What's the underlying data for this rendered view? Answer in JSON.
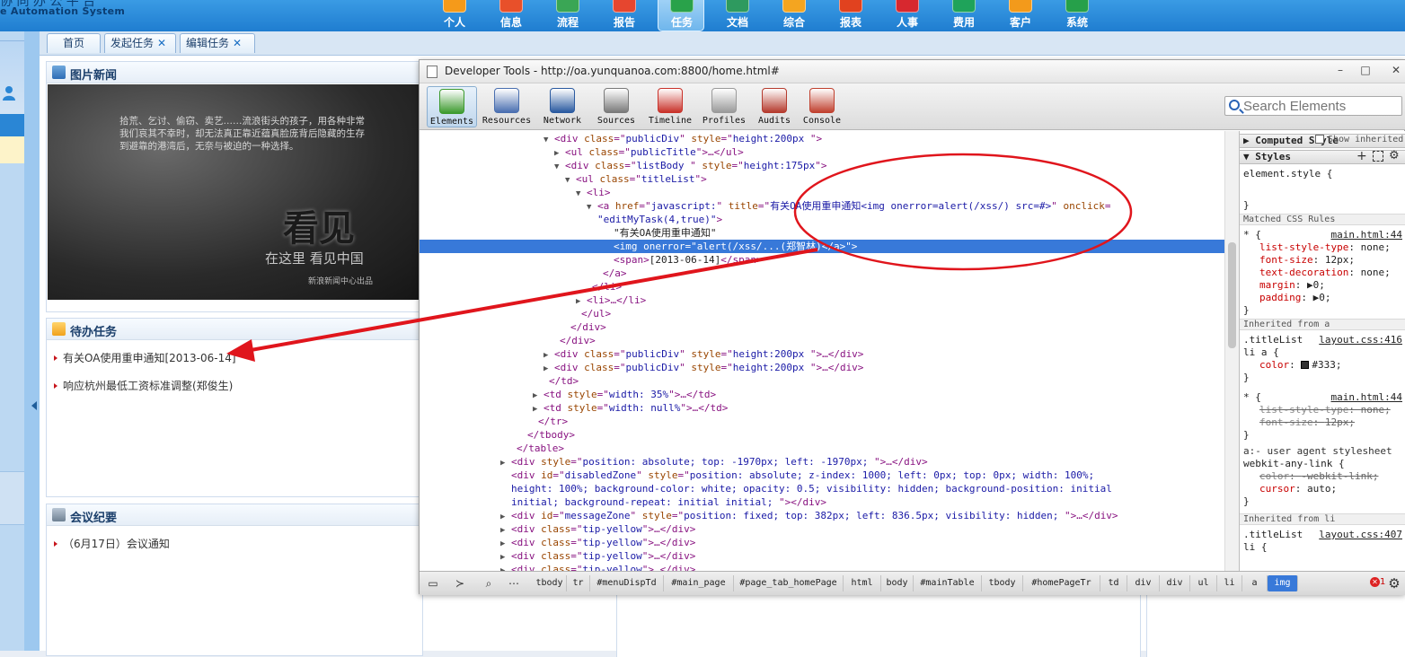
{
  "app": {
    "logo_main": "协 同 办 公 平 台",
    "logo_sub": "e Automation System",
    "modules": [
      {
        "label": "个人",
        "color": "#f59a1a"
      },
      {
        "label": "信息",
        "color": "#e8502a"
      },
      {
        "label": "流程",
        "color": "#3aa655"
      },
      {
        "label": "报告",
        "color": "#e6462f"
      },
      {
        "label": "任务",
        "color": "#29a24a"
      },
      {
        "label": "文档",
        "color": "#2e9a5f"
      },
      {
        "label": "综合",
        "color": "#f4a520"
      },
      {
        "label": "报表",
        "color": "#e1421f"
      },
      {
        "label": "人事",
        "color": "#d7282f"
      },
      {
        "label": "费用",
        "color": "#1fa35a"
      },
      {
        "label": "客户",
        "color": "#f39a1b"
      },
      {
        "label": "系统",
        "color": "#26a04a"
      }
    ],
    "active_module": "任务",
    "tabs": [
      {
        "label": "首页",
        "closable": false
      },
      {
        "label": "发起任务",
        "closable": true
      },
      {
        "label": "编辑任务",
        "closable": true
      }
    ],
    "close_glyph": "✕"
  },
  "panels": {
    "news": {
      "title": "图片新闻",
      "image_text_1": "拾荒、乞讨、偷窃、卖艺……流浪街头的孩子，用各种非常",
      "image_text_2": "我们哀其不幸时，却无法真正靠近蕴真脸庞背后隐藏的生存",
      "image_text_3": "到避靠的港湾后，无奈与被迫的一种选择。",
      "image_logo": "看见",
      "image_slogan": "在这里 看见中国",
      "image_credit": "新浪新闻中心出品"
    },
    "tasks": {
      "title": "待办任务",
      "items": [
        "有关OA使用重申通知[2013-06-14]",
        "响应杭州最低工资标准调整(郑俊生)"
      ]
    },
    "meetings": {
      "title": "会议纪要",
      "items": [
        "（6月17日）会议通知"
      ]
    }
  },
  "devtools": {
    "title": "Developer Tools - http://oa.yunquanoa.com:8800/home.html#",
    "window_buttons": [
      "–",
      "□",
      "✕"
    ],
    "tools": [
      {
        "label": "Elements",
        "active": true,
        "color": "#3c9a2e"
      },
      {
        "label": "Resources",
        "active": false,
        "color": "#4a6fb0"
      },
      {
        "label": "Network",
        "active": false,
        "color": "#2a5aa0"
      },
      {
        "label": "Sources",
        "active": false,
        "color": "#7a7a7a"
      },
      {
        "label": "Timeline",
        "active": false,
        "color": "#c9322a"
      },
      {
        "label": "Profiles",
        "active": false,
        "color": "#9a9a9a"
      },
      {
        "label": "Audits",
        "active": false,
        "color": "#b53b2e"
      },
      {
        "label": "Console",
        "active": false,
        "color": "#c0412f"
      }
    ],
    "search_placeholder": "Search Elements",
    "dom_lines": [
      {
        "indent": 24,
        "tw": "▼",
        "parts": [
          [
            "tg",
            "<div "
          ],
          [
            "an",
            "class"
          ],
          [
            "tg",
            "=\""
          ],
          [
            "av",
            "publicDiv"
          ],
          [
            "tg",
            "\" "
          ],
          [
            "an",
            "style"
          ],
          [
            "tg",
            "=\""
          ],
          [
            "av",
            "height:200px "
          ],
          [
            "tg",
            "\">"
          ]
        ]
      },
      {
        "indent": 26,
        "tw": "▶",
        "parts": [
          [
            "tg",
            "<ul "
          ],
          [
            "an",
            "class"
          ],
          [
            "tg",
            "=\""
          ],
          [
            "av",
            "publicTitle"
          ],
          [
            "tg",
            "\">…</ul>"
          ]
        ]
      },
      {
        "indent": 26,
        "tw": "▼",
        "parts": [
          [
            "tg",
            "<div "
          ],
          [
            "an",
            "class"
          ],
          [
            "tg",
            "=\""
          ],
          [
            "av",
            "listBody "
          ],
          [
            "tg",
            "\" "
          ],
          [
            "an",
            "style"
          ],
          [
            "tg",
            "=\""
          ],
          [
            "av",
            "height:175px"
          ],
          [
            "tg",
            "\">"
          ]
        ]
      },
      {
        "indent": 28,
        "tw": "▼",
        "parts": [
          [
            "tg",
            "<ul "
          ],
          [
            "an",
            "class"
          ],
          [
            "tg",
            "=\""
          ],
          [
            "av",
            "titleList"
          ],
          [
            "tg",
            "\">"
          ]
        ]
      },
      {
        "indent": 30,
        "tw": "▼",
        "parts": [
          [
            "tg",
            "<li>"
          ]
        ]
      },
      {
        "indent": 32,
        "tw": "▼",
        "parts": [
          [
            "tg",
            "<a "
          ],
          [
            "an",
            "href"
          ],
          [
            "tg",
            "=\""
          ],
          [
            "av",
            "javascript:"
          ],
          [
            "tg",
            "\" "
          ],
          [
            "an",
            "title"
          ],
          [
            "tg",
            "=\""
          ],
          [
            "av",
            "有关OA使用重申通知<img onerror=alert(/xss/) src=#>"
          ],
          [
            "tg",
            "\" "
          ],
          [
            "an",
            "onclick"
          ],
          [
            "tg",
            "="
          ]
        ]
      },
      {
        "indent": 32,
        "tw": "",
        "parts": [
          [
            "av",
            "\"editMyTask(4,true)\""
          ],
          [
            "tg",
            ">"
          ]
        ]
      },
      {
        "indent": 35,
        "tw": "",
        "parts": [
          [
            "tx",
            "\"有关OA使用重申通知\""
          ]
        ]
      },
      {
        "indent": 35,
        "tw": "",
        "sel": true,
        "parts": [
          [
            "tg",
            "<img "
          ],
          [
            "an",
            "onerror"
          ],
          [
            "tg",
            "=\""
          ],
          [
            "av",
            "alert(/xss/...(郑智林)</a>"
          ],
          [
            "tg",
            "\">"
          ]
        ]
      },
      {
        "indent": 35,
        "tw": "",
        "parts": [
          [
            "tg",
            "<span>"
          ],
          [
            "tx",
            "[2013-06-14]"
          ],
          [
            "tg",
            "</span>"
          ]
        ]
      },
      {
        "indent": 33,
        "tw": "",
        "parts": [
          [
            "tg",
            "</a>"
          ]
        ]
      },
      {
        "indent": 31,
        "tw": "",
        "parts": [
          [
            "tg",
            "</li>"
          ]
        ]
      },
      {
        "indent": 30,
        "tw": "▶",
        "parts": [
          [
            "tg",
            "<li>…</li>"
          ]
        ]
      },
      {
        "indent": 29,
        "tw": "",
        "parts": [
          [
            "tg",
            "</ul>"
          ]
        ]
      },
      {
        "indent": 27,
        "tw": "",
        "parts": [
          [
            "tg",
            "</div>"
          ]
        ]
      },
      {
        "indent": 25,
        "tw": "",
        "parts": [
          [
            "tg",
            "</div>"
          ]
        ]
      },
      {
        "indent": 24,
        "tw": "▶",
        "parts": [
          [
            "tg",
            "<div "
          ],
          [
            "an",
            "class"
          ],
          [
            "tg",
            "=\""
          ],
          [
            "av",
            "publicDiv"
          ],
          [
            "tg",
            "\" "
          ],
          [
            "an",
            "style"
          ],
          [
            "tg",
            "=\""
          ],
          [
            "av",
            "height:200px "
          ],
          [
            "tg",
            "\">…</div>"
          ]
        ]
      },
      {
        "indent": 24,
        "tw": "▶",
        "parts": [
          [
            "tg",
            "<div "
          ],
          [
            "an",
            "class"
          ],
          [
            "tg",
            "=\""
          ],
          [
            "av",
            "publicDiv"
          ],
          [
            "tg",
            "\" "
          ],
          [
            "an",
            "style"
          ],
          [
            "tg",
            "=\""
          ],
          [
            "av",
            "height:200px "
          ],
          [
            "tg",
            "\">…</div>"
          ]
        ]
      },
      {
        "indent": 23,
        "tw": "",
        "parts": [
          [
            "tg",
            "</td>"
          ]
        ]
      },
      {
        "indent": 22,
        "tw": "▶",
        "parts": [
          [
            "tg",
            "<td "
          ],
          [
            "an",
            "style"
          ],
          [
            "tg",
            "=\""
          ],
          [
            "av",
            "width: 35%"
          ],
          [
            "tg",
            "\">…</td>"
          ]
        ]
      },
      {
        "indent": 22,
        "tw": "▶",
        "parts": [
          [
            "tg",
            "<td "
          ],
          [
            "an",
            "style"
          ],
          [
            "tg",
            "=\""
          ],
          [
            "av",
            "width: null%"
          ],
          [
            "tg",
            "\">…</td>"
          ]
        ]
      },
      {
        "indent": 21,
        "tw": "",
        "parts": [
          [
            "tg",
            "</tr>"
          ]
        ]
      },
      {
        "indent": 19,
        "tw": "",
        "parts": [
          [
            "tg",
            "</tbody>"
          ]
        ]
      },
      {
        "indent": 17,
        "tw": "",
        "parts": [
          [
            "tg",
            "</table>"
          ]
        ]
      },
      {
        "indent": 16,
        "tw": "▶",
        "parts": [
          [
            "tg",
            "<div "
          ],
          [
            "an",
            "style"
          ],
          [
            "tg",
            "=\""
          ],
          [
            "av",
            "position: absolute; top: -1970px; left: -1970px; "
          ],
          [
            "tg",
            "\">…</div>"
          ]
        ]
      },
      {
        "indent": 16,
        "tw": "",
        "parts": [
          [
            "tg",
            "<div "
          ],
          [
            "an",
            "id"
          ],
          [
            "tg",
            "=\""
          ],
          [
            "av",
            "disabledZone"
          ],
          [
            "tg",
            "\" "
          ],
          [
            "an",
            "style"
          ],
          [
            "tg",
            "=\""
          ],
          [
            "av",
            "position: absolute; z-index: 1000; left: 0px; top: 0px; width: 100%;"
          ]
        ]
      },
      {
        "indent": 16,
        "tw": "",
        "parts": [
          [
            "av",
            "height: 100%; background-color: white; opacity: 0.5; visibility: hidden; background-position: initial"
          ]
        ]
      },
      {
        "indent": 16,
        "tw": "",
        "parts": [
          [
            "av",
            "initial; background-repeat: initial initial; "
          ],
          [
            "tg",
            "\"></div>"
          ]
        ]
      },
      {
        "indent": 16,
        "tw": "▶",
        "parts": [
          [
            "tg",
            "<div "
          ],
          [
            "an",
            "id"
          ],
          [
            "tg",
            "=\""
          ],
          [
            "av",
            "messageZone"
          ],
          [
            "tg",
            "\" "
          ],
          [
            "an",
            "style"
          ],
          [
            "tg",
            "=\""
          ],
          [
            "av",
            "position: fixed; top: 382px; left: 836.5px; visibility: hidden; "
          ],
          [
            "tg",
            "\">…</div>"
          ]
        ]
      },
      {
        "indent": 16,
        "tw": "▶",
        "parts": [
          [
            "tg",
            "<div "
          ],
          [
            "an",
            "class"
          ],
          [
            "tg",
            "=\""
          ],
          [
            "av",
            "tip-yellow"
          ],
          [
            "tg",
            "\">…</div>"
          ]
        ]
      },
      {
        "indent": 16,
        "tw": "▶",
        "parts": [
          [
            "tg",
            "<div "
          ],
          [
            "an",
            "class"
          ],
          [
            "tg",
            "=\""
          ],
          [
            "av",
            "tip-yellow"
          ],
          [
            "tg",
            "\">…</div>"
          ]
        ]
      },
      {
        "indent": 16,
        "tw": "▶",
        "parts": [
          [
            "tg",
            "<div "
          ],
          [
            "an",
            "class"
          ],
          [
            "tg",
            "=\""
          ],
          [
            "av",
            "tip-yellow"
          ],
          [
            "tg",
            "\">…</div>"
          ]
        ]
      },
      {
        "indent": 16,
        "tw": "▶",
        "parts": [
          [
            "tg",
            "<div "
          ],
          [
            "an",
            "class"
          ],
          [
            "tg",
            "=\""
          ],
          [
            "av",
            "tip-yellow"
          ],
          [
            "tg",
            "\">…</div>"
          ]
        ]
      }
    ],
    "sidebar": {
      "computed_label": "Computed Style",
      "show_inherited_label": "Show inherited",
      "styles_label": "Styles",
      "element_style": "element.style {",
      "close_brace": "}",
      "matched_rules_label": "Matched CSS Rules",
      "rule1_selector": "* {",
      "rule1_source": "main.html:44",
      "rule1_props": [
        {
          "name": "list-style-type",
          "value": "none;"
        },
        {
          "name": "font-size",
          "value": "12px;"
        },
        {
          "name": "text-decoration",
          "value": "none;"
        },
        {
          "name": "margin",
          "value": "▶0;"
        },
        {
          "name": "padding",
          "value": "▶0;"
        }
      ],
      "inherited_a_label": "Inherited from a",
      "rule2_selector": ".titleList",
      "rule2_source": "layout.css:416",
      "rule2_selector_2": "li a {",
      "rule2_prop_name": "color",
      "rule2_prop_value": "#333;",
      "rule3_selector": "* {",
      "rule3_source": "main.html:44",
      "rule3_props": [
        {
          "name": "list-style-type",
          "value": "none;"
        },
        {
          "name": "font-size",
          "value": "12px;"
        }
      ],
      "ua_label": "a:- user agent stylesheet",
      "ua_selector": "webkit-any-link {",
      "ua_props": [
        {
          "name": "color",
          "value": "-webkit-link;",
          "struck": true
        },
        {
          "name": "cursor",
          "value": "auto;",
          "struck": false
        }
      ],
      "inherited_li_label": "Inherited from li",
      "rule4_selector": ".titleList",
      "rule4_source": "layout.css:407",
      "rule4_selector_2": "li {"
    },
    "breadcrumbs": [
      "tbody",
      "tr",
      "#menuDispTd",
      "#main_page",
      "#page_tab_homePage",
      "html",
      "body",
      "#mainTable",
      "tbody",
      "#homePageTr",
      "td",
      "div",
      "div",
      "ul",
      "li",
      "a",
      "img"
    ],
    "error_count": "1"
  },
  "annotation": {
    "circle_color": "#e0151c",
    "arrow_color": "#e0151c"
  }
}
